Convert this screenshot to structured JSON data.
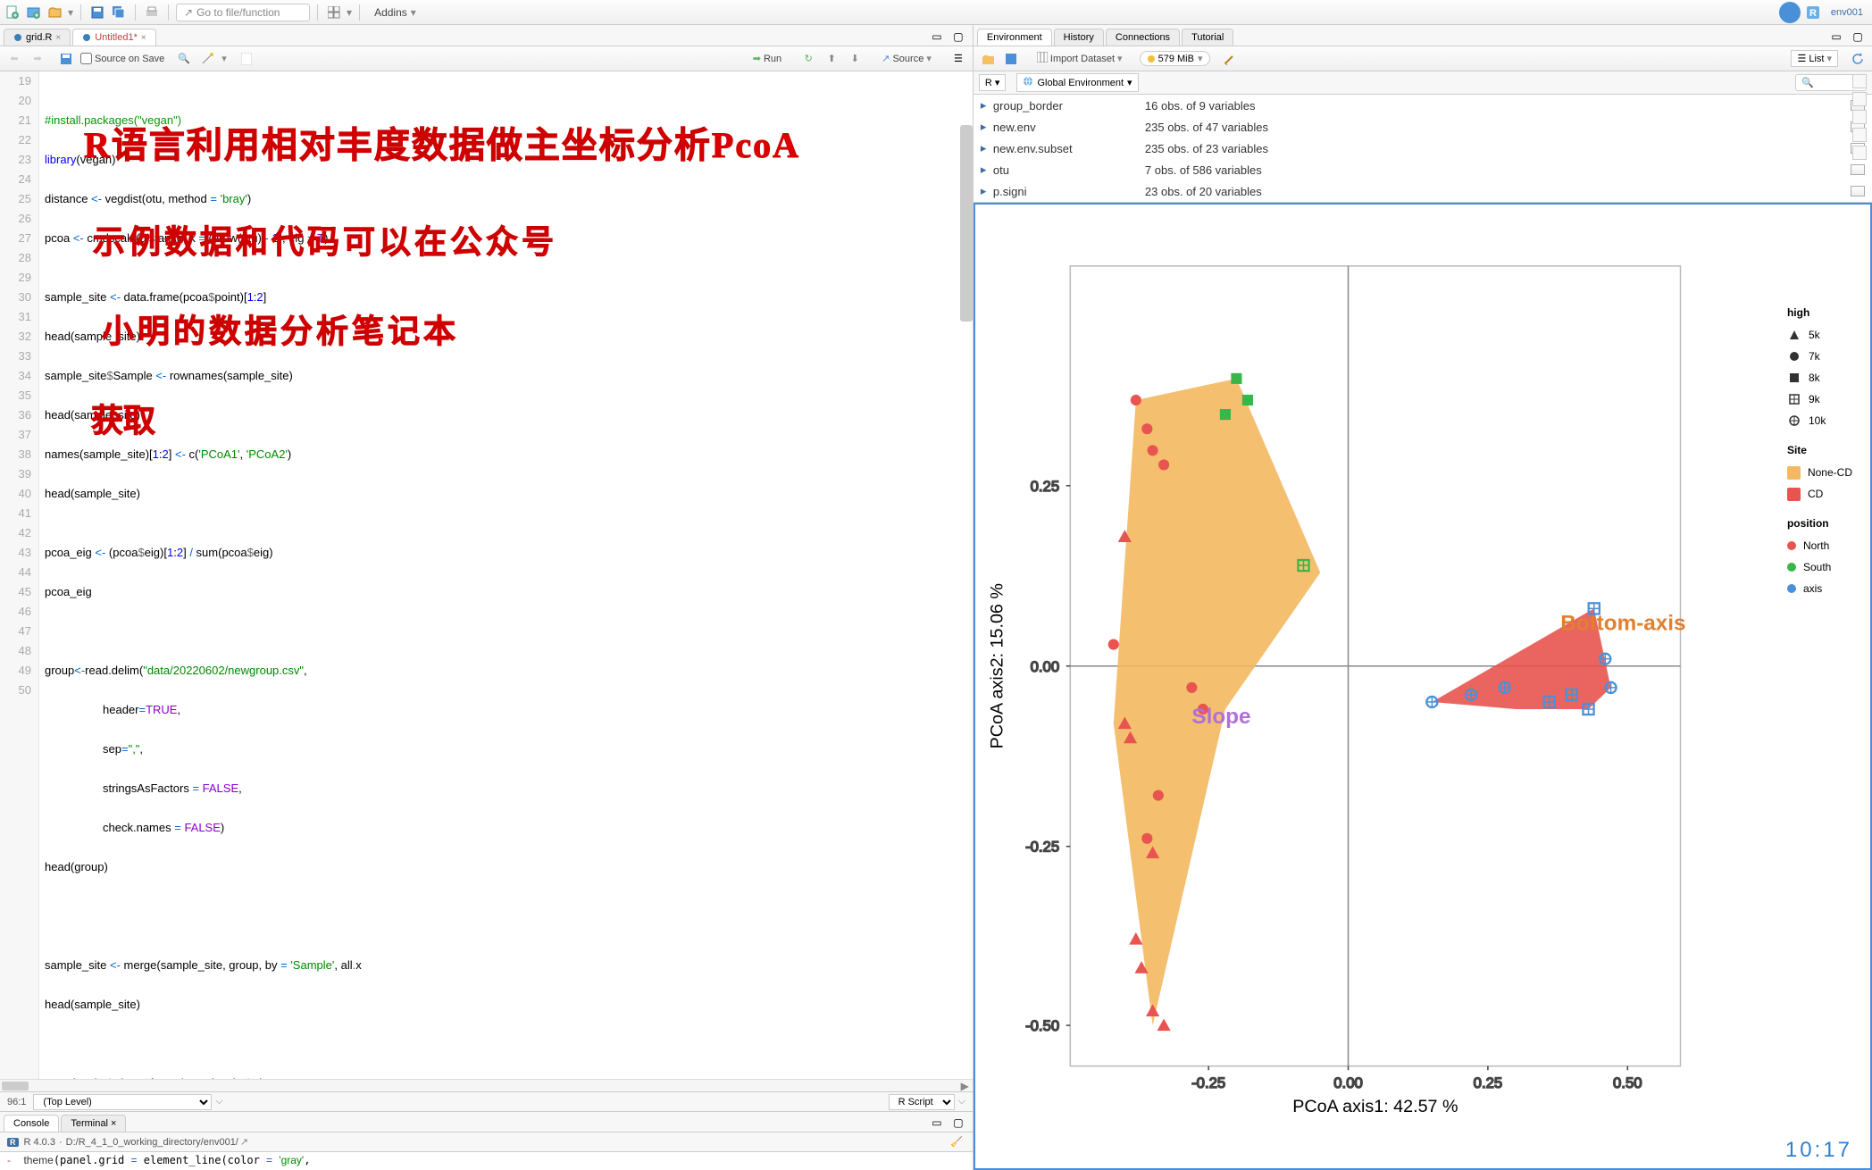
{
  "top_toolbar": {
    "goto_placeholder": "Go to file/function",
    "addins_label": "Addins",
    "env_label": "env001"
  },
  "editor_tabs": {
    "tab1": "grid.R",
    "tab2": "Untitled1*"
  },
  "editor_toolbar": {
    "source_on_save": "Source on Save",
    "run_label": "Run",
    "source_label": "Source"
  },
  "code_lines": {
    "l19": "",
    "l20_cm": "#install.packages(\"vegan\")",
    "l21a": "library",
    "l21b": "(vegan)",
    "l22": "distance <- vegdist(otu, method = 'bray')",
    "l23": "pcoa <- cmdscale(distance, k = (nrow(otu) - 1), eig = T)",
    "l24": "",
    "l25": "sample_site <- data.frame(pcoa$point)[1:2]",
    "l26": "head(sample_site)",
    "l27": "sample_site$Sample <- rownames(sample_site)",
    "l28": "head(sample_site)",
    "l29": "names(sample_site)[1:2] <- c('PCoA1', 'PCoA2')",
    "l30": "head(sample_site)",
    "l31": "",
    "l32": "pcoa_eig <- (pcoa$eig)[1:2] / sum(pcoa$eig)",
    "l33": "pcoa_eig",
    "l34": "",
    "l35": "",
    "l36a": "group<-read.delim(",
    "l36b": "\"data/20220602/newgroup.csv\"",
    "l36c": ",",
    "l37a": "                  header=",
    "l37b": "TRUE",
    "l37c": ",",
    "l38a": "                  sep=",
    "l38b": "\",\"",
    "l38c": ",",
    "l39a": "                  stringsAsFactors = ",
    "l39b": "FALSE",
    "l39c": ",",
    "l40a": "                  check.names = ",
    "l40b": "FALSE",
    "l40c": ")",
    "l41": "head(group)",
    "l42": "",
    "l43": "",
    "l44": "",
    "l45": "sample_site <- merge(sample_site, group, by = 'Sample', all.x",
    "l46": "head(sample_site)",
    "l47": "",
    "l48": "",
    "l49": "sample_site$Site <- factor(sample_site$Site,",
    "l50": ""
  },
  "line_numbers": [
    "19",
    "20",
    "21",
    "22",
    "23",
    "24",
    "25",
    "26",
    "27",
    "28",
    "29",
    "30",
    "31",
    "32",
    "33",
    "34",
    "35",
    "36",
    "37",
    "38",
    "39",
    "40",
    "41",
    "42",
    "43",
    "44",
    "45",
    "46",
    "47",
    "48",
    "49",
    "50"
  ],
  "overlays": {
    "ov1": "R语言利用相对丰度数据做主坐标分析PcoA",
    "ov2": "示例数据和代码可以在公众号",
    "ov3": "小明的数据分析笔记本",
    "ov4": "获取"
  },
  "editor_status": {
    "cursor_pos": "96:1",
    "scope": "(Top Level)",
    "file_type": "R Script"
  },
  "console": {
    "tab1": "Console",
    "tab2": "Terminal",
    "version": "R 4.0.3",
    "path": "D:/R_4_1_0_working_directory/env001/",
    "line1": "  theme(panel.grid = element_line(color = 'gray',"
  },
  "env_panel": {
    "tabs": {
      "t1": "Environment",
      "t2": "History",
      "t3": "Connections",
      "t4": "Tutorial"
    },
    "import_label": "Import Dataset",
    "memory": "579 MiB",
    "list_label": "List",
    "scope_r": "R",
    "scope_global": "Global Environment",
    "vars": [
      {
        "name": "group_border",
        "desc": "16 obs. of 9 variables"
      },
      {
        "name": "new.env",
        "desc": "235 obs. of 47 variables"
      },
      {
        "name": "new.env.subset",
        "desc": "235 obs. of 23 variables"
      },
      {
        "name": "otu",
        "desc": "7 obs. of 586 variables"
      },
      {
        "name": "p.signi",
        "desc": "23 obs. of 20 variables"
      }
    ]
  },
  "chart_data": {
    "type": "scatter",
    "title": "",
    "xlabel": "PCoA axis1: 42.57 %",
    "ylabel": "PCoA axis2: 15.06 %",
    "xlim": [
      -0.5,
      0.5
    ],
    "ylim": [
      -0.5,
      0.5
    ],
    "xticks": [
      -0.25,
      0.0,
      0.25,
      0.5
    ],
    "yticks": [
      -0.5,
      -0.25,
      0.0,
      0.25
    ],
    "annotations": [
      {
        "label": "Slope",
        "x": -0.28,
        "y": -0.08,
        "color": "#b070d8"
      },
      {
        "label": "Bottom-axis",
        "x": 0.38,
        "y": 0.05,
        "color": "#e08030"
      }
    ],
    "polygons": [
      {
        "site": "None-CD",
        "fill": "#f4b860",
        "points": [
          [
            -0.38,
            0.37
          ],
          [
            -0.2,
            0.4
          ],
          [
            -0.05,
            0.13
          ],
          [
            -0.22,
            -0.06
          ],
          [
            -0.35,
            -0.5
          ],
          [
            -0.42,
            -0.08
          ]
        ]
      },
      {
        "site": "CD",
        "fill": "#e8544f",
        "points": [
          [
            0.15,
            -0.05
          ],
          [
            0.44,
            0.08
          ],
          [
            0.47,
            -0.03
          ],
          [
            0.43,
            -0.06
          ],
          [
            0.3,
            -0.06
          ]
        ]
      }
    ],
    "series": [
      {
        "name": "North",
        "color": "#e8544f",
        "shape": "circle"
      },
      {
        "name": "South",
        "color": "#3ab54a",
        "shape": "circle"
      },
      {
        "name": "axis",
        "color": "#4a90d9",
        "shape": "circle"
      }
    ],
    "legends": {
      "high_title": "high",
      "high_items": [
        {
          "label": "5k",
          "shape": "triangle"
        },
        {
          "label": "7k",
          "shape": "circle"
        },
        {
          "label": "8k",
          "shape": "square"
        },
        {
          "label": "9k",
          "shape": "square-cross"
        },
        {
          "label": "10k",
          "shape": "circle-cross"
        }
      ],
      "site_title": "Site",
      "site_items": [
        {
          "label": "None-CD",
          "color": "#f4b860"
        },
        {
          "label": "CD",
          "color": "#e8544f"
        }
      ],
      "position_title": "position",
      "position_items": [
        {
          "label": "North",
          "color": "#e8544f"
        },
        {
          "label": "South",
          "color": "#3ab54a"
        },
        {
          "label": "axis",
          "color": "#4a90d9"
        }
      ]
    },
    "points": [
      {
        "x": -0.38,
        "y": 0.37,
        "pos": "North",
        "high": "7k"
      },
      {
        "x": -0.36,
        "y": 0.33,
        "pos": "North",
        "high": "7k"
      },
      {
        "x": -0.35,
        "y": 0.3,
        "pos": "North",
        "high": "7k"
      },
      {
        "x": -0.33,
        "y": 0.28,
        "pos": "North",
        "high": "7k"
      },
      {
        "x": -0.4,
        "y": 0.18,
        "pos": "North",
        "high": "5k"
      },
      {
        "x": -0.42,
        "y": 0.03,
        "pos": "North",
        "high": "7k"
      },
      {
        "x": -0.28,
        "y": -0.03,
        "pos": "North",
        "high": "7k"
      },
      {
        "x": -0.26,
        "y": -0.06,
        "pos": "North",
        "high": "7k"
      },
      {
        "x": -0.4,
        "y": -0.08,
        "pos": "North",
        "high": "5k"
      },
      {
        "x": -0.39,
        "y": -0.1,
        "pos": "North",
        "high": "5k"
      },
      {
        "x": -0.34,
        "y": -0.18,
        "pos": "North",
        "high": "7k"
      },
      {
        "x": -0.36,
        "y": -0.24,
        "pos": "North",
        "high": "7k"
      },
      {
        "x": -0.35,
        "y": -0.26,
        "pos": "North",
        "high": "5k"
      },
      {
        "x": -0.38,
        "y": -0.38,
        "pos": "North",
        "high": "5k"
      },
      {
        "x": -0.37,
        "y": -0.42,
        "pos": "North",
        "high": "5k"
      },
      {
        "x": -0.35,
        "y": -0.48,
        "pos": "North",
        "high": "5k"
      },
      {
        "x": -0.33,
        "y": -0.5,
        "pos": "North",
        "high": "5k"
      },
      {
        "x": -0.2,
        "y": 0.4,
        "pos": "South",
        "high": "8k"
      },
      {
        "x": -0.18,
        "y": 0.37,
        "pos": "South",
        "high": "8k"
      },
      {
        "x": -0.22,
        "y": 0.35,
        "pos": "South",
        "high": "8k"
      },
      {
        "x": -0.08,
        "y": 0.14,
        "pos": "South",
        "high": "9k"
      },
      {
        "x": 0.15,
        "y": -0.05,
        "pos": "axis",
        "high": "10k"
      },
      {
        "x": 0.22,
        "y": -0.04,
        "pos": "axis",
        "high": "10k"
      },
      {
        "x": 0.28,
        "y": -0.03,
        "pos": "axis",
        "high": "10k"
      },
      {
        "x": 0.36,
        "y": -0.05,
        "pos": "axis",
        "high": "9k"
      },
      {
        "x": 0.4,
        "y": -0.04,
        "pos": "axis",
        "high": "9k"
      },
      {
        "x": 0.44,
        "y": 0.08,
        "pos": "axis",
        "high": "9k"
      },
      {
        "x": 0.46,
        "y": 0.01,
        "pos": "axis",
        "high": "10k"
      },
      {
        "x": 0.47,
        "y": -0.03,
        "pos": "axis",
        "high": "10k"
      },
      {
        "x": 0.43,
        "y": -0.06,
        "pos": "axis",
        "high": "9k"
      }
    ]
  },
  "timestamp": "10:17"
}
